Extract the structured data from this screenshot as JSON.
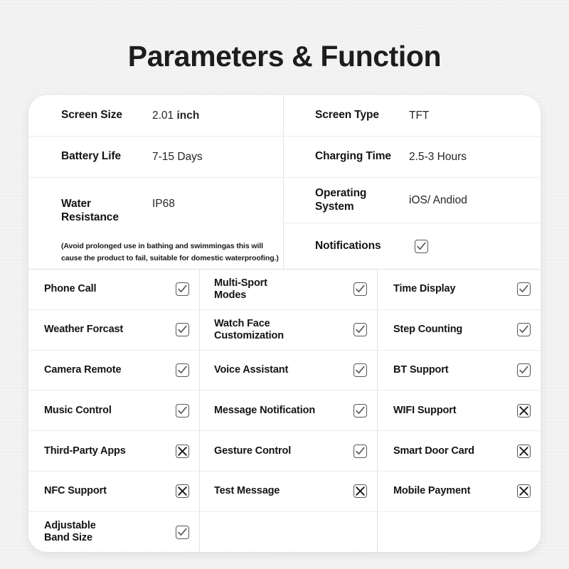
{
  "page": {
    "title": "Parameters & Function",
    "background_color": "#eeeeee",
    "card_color": "#ffffff"
  },
  "specs": {
    "left": [
      {
        "label": "Screen Size",
        "value": "2.01",
        "unit": "inch"
      },
      {
        "label": "Battery Life",
        "value": "7-15 Days",
        "unit": ""
      },
      {
        "label": "Water\nResistance",
        "value": "IP68",
        "unit": ""
      }
    ],
    "left_labels": {
      "screen_size": "Screen Size",
      "battery_life": "Battery Life",
      "water_resistance_line1": "Water",
      "water_resistance_line2": "Resistance"
    },
    "left_values": {
      "screen_size_number": "2.01",
      "screen_size_unit": "inch",
      "battery_life": "7-15 Days",
      "water_resistance": "IP68"
    },
    "water_note": "(Avoid prolonged use in bathing and swimmingas this will cause the product to fail, suitable for domestic waterproofing.)",
    "right_labels": {
      "screen_type": "Screen Type",
      "charging_time": "Charging Time",
      "operating_system_line1": "Operating",
      "operating_system_line2": "System",
      "notifications": "Notifications"
    },
    "right_values": {
      "screen_type": "TFT",
      "charging_time": "2.5-3 Hours",
      "operating_system": "iOS/ Andiod"
    },
    "notifications_state": "checked"
  },
  "features": {
    "column1": [
      {
        "label": "Phone Call",
        "state": "checked"
      },
      {
        "label": "Weather Forcast",
        "state": "checked"
      },
      {
        "label": "Camera Remote",
        "state": "checked"
      },
      {
        "label": "Music Control",
        "state": "checked"
      },
      {
        "label": "Third-Party Apps",
        "state": "crossed"
      },
      {
        "label": "NFC Support",
        "state": "crossed"
      },
      {
        "label": "Adjustable\nBand Size",
        "state": "checked"
      }
    ],
    "column2": [
      {
        "label": "Multi-Sport\nModes",
        "state": "checked"
      },
      {
        "label": "Watch Face\nCustomization",
        "state": "checked"
      },
      {
        "label": "Voice Assistant",
        "state": "checked"
      },
      {
        "label": "Message Notification",
        "state": "checked"
      },
      {
        "label": "Gesture Control",
        "state": "checked"
      },
      {
        "label": "Test Message",
        "state": "crossed"
      },
      {
        "label": "",
        "state": "empty"
      }
    ],
    "column3": [
      {
        "label": "Time Display",
        "state": "checked"
      },
      {
        "label": "Step Counting",
        "state": "checked"
      },
      {
        "label": "BT Support",
        "state": "checked"
      },
      {
        "label": "WIFI Support",
        "state": "crossed"
      },
      {
        "label": "Smart Door Card",
        "state": "crossed"
      },
      {
        "label": "Mobile Payment",
        "state": "crossed"
      },
      {
        "label": "",
        "state": "empty"
      }
    ]
  },
  "icons": {
    "checkbox_checked": "check-box-icon",
    "checkbox_crossed": "cross-box-icon"
  }
}
